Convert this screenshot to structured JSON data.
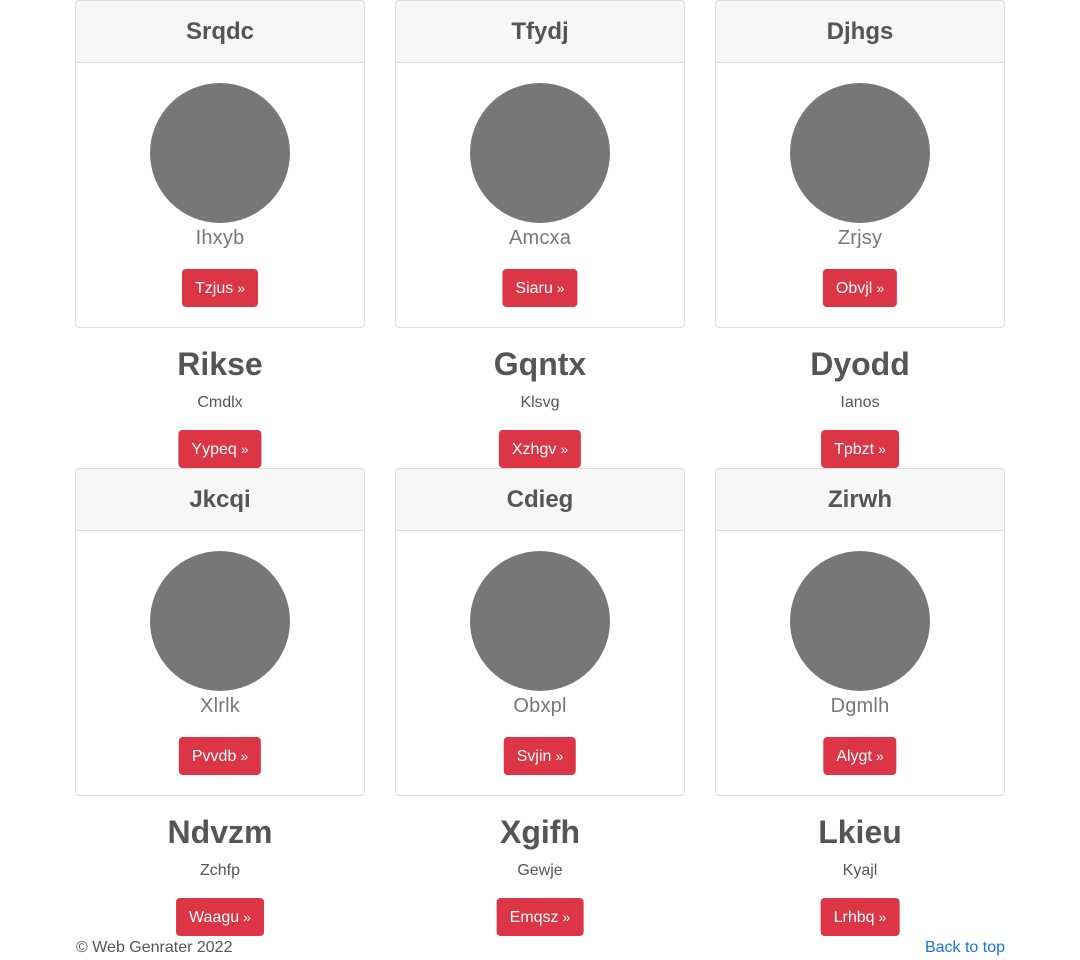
{
  "colors": {
    "accent_button": "#dc3545",
    "avatar_placeholder": "#777777",
    "card_header_bg": "#f7f7f7",
    "link": "#1a73e8"
  },
  "icons": {
    "button_suffix": "»"
  },
  "rows": [
    {
      "cards": [
        {
          "header": "Srqdc",
          "subtitle": "Ihxyb",
          "button": "Tzjus"
        },
        {
          "header": "Tfydj",
          "subtitle": "Amcxa",
          "button": "Siaru"
        },
        {
          "header": "Djhgs",
          "subtitle": "Zrjsy",
          "button": "Obvjl"
        }
      ],
      "features": [
        {
          "title": "Rikse",
          "text": "Cmdlx",
          "button": "Yypeq"
        },
        {
          "title": "Gqntx",
          "text": "Klsvg",
          "button": "Xzhgv"
        },
        {
          "title": "Dyodd",
          "text": "Ianos",
          "button": "Tpbzt"
        }
      ]
    },
    {
      "cards": [
        {
          "header": "Jkcqi",
          "subtitle": "Xlrlk",
          "button": "Pvvdb"
        },
        {
          "header": "Cdieg",
          "subtitle": "Obxpl",
          "button": "Svjin"
        },
        {
          "header": "Zirwh",
          "subtitle": "Dgmlh",
          "button": "Alygt"
        }
      ],
      "features": [
        {
          "title": "Ndvzm",
          "text": "Zchfp",
          "button": "Waagu"
        },
        {
          "title": "Xgifh",
          "text": "Gewje",
          "button": "Emqsz"
        },
        {
          "title": "Lkieu",
          "text": "Kyajl",
          "button": "Lrhbq"
        }
      ]
    }
  ],
  "footer": {
    "copyright": "© Web Genrater 2022",
    "back_to_top": "Back to top"
  }
}
